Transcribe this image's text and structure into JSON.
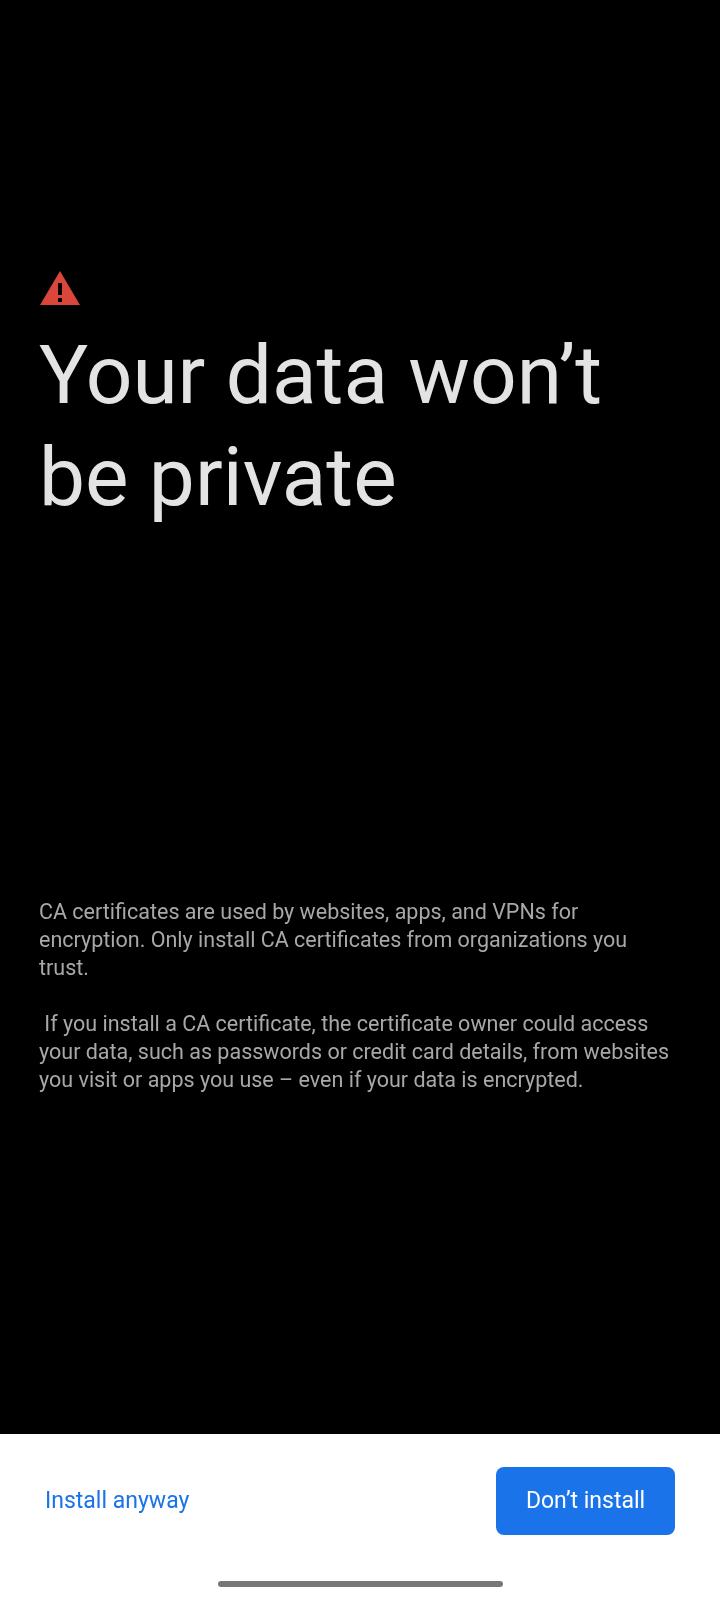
{
  "title": "Your data won’t be private",
  "paragraphs": [
    "CA certificates are used by websites, apps, and VPNs for encryption. Only install CA certificates from organizations you trust.",
    " If you install a CA certificate, the certificate owner could access your data, such as passwords or credit card details, from websites you visit or apps you use – even if your data is encrypted."
  ],
  "buttons": [
    {
      "label": "Install anyway",
      "kind": "text"
    },
    {
      "label": "Don’t install",
      "kind": "filled"
    }
  ]
}
